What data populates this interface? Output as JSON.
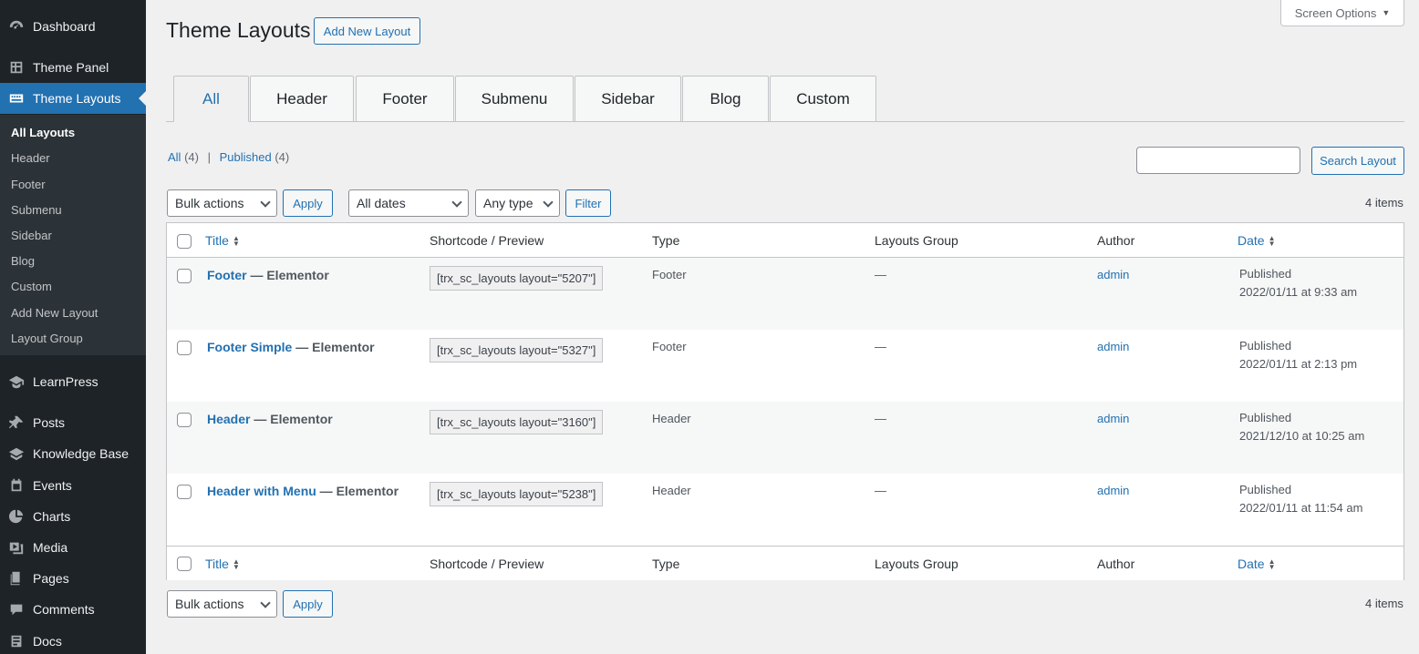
{
  "sidebar": {
    "items": [
      {
        "label": "Dashboard",
        "icon": "dashboard-icon"
      },
      {
        "label": "Theme Panel",
        "icon": "theme-panel-icon"
      },
      {
        "label": "Theme Layouts",
        "icon": "keyboard-icon"
      },
      {
        "label": "LearnPress",
        "icon": "graduation-cap-icon"
      },
      {
        "label": "Posts",
        "icon": "pushpin-icon"
      },
      {
        "label": "Knowledge Base",
        "icon": "knowledge-base-icon"
      },
      {
        "label": "Events",
        "icon": "events-icon"
      },
      {
        "label": "Charts",
        "icon": "pie-chart-icon"
      },
      {
        "label": "Media",
        "icon": "media-icon"
      },
      {
        "label": "Pages",
        "icon": "pages-icon"
      },
      {
        "label": "Comments",
        "icon": "comments-icon"
      },
      {
        "label": "Docs",
        "icon": "docs-icon"
      }
    ],
    "submenu": [
      "All Layouts",
      "Header",
      "Footer",
      "Submenu",
      "Sidebar",
      "Blog",
      "Custom",
      "Add New Layout",
      "Layout Group"
    ]
  },
  "screen_options": "Screen Options",
  "page": {
    "title": "Theme Layouts",
    "add_new": "Add New Layout"
  },
  "tabs": [
    "All",
    "Header",
    "Footer",
    "Submenu",
    "Sidebar",
    "Blog",
    "Custom"
  ],
  "filters": {
    "all_label": "All",
    "all_count": "(4)",
    "separator": "|",
    "published_label": "Published",
    "published_count": "(4)",
    "search_button": "Search Layout",
    "bulk_actions": "Bulk actions",
    "apply": "Apply",
    "dates": "All dates",
    "type": "Any type",
    "filter": "Filter",
    "items_count": "4 items"
  },
  "table": {
    "columns": {
      "title": "Title",
      "shortcode": "Shortcode / Preview",
      "type": "Type",
      "group": "Layouts Group",
      "author": "Author",
      "date": "Date"
    },
    "rows": [
      {
        "title": "Footer",
        "state": " — Elementor",
        "shortcode": "[trx_sc_layouts layout=\"5207\"]",
        "type": "Footer",
        "group": "—",
        "author": "admin",
        "status": "Published",
        "date": "2022/01/11 at 9:33 am"
      },
      {
        "title": "Footer Simple",
        "state": " — Elementor",
        "shortcode": "[trx_sc_layouts layout=\"5327\"]",
        "type": "Footer",
        "group": "—",
        "author": "admin",
        "status": "Published",
        "date": "2022/01/11 at 2:13 pm"
      },
      {
        "title": "Header",
        "state": " — Elementor",
        "shortcode": "[trx_sc_layouts layout=\"3160\"]",
        "type": "Header",
        "group": "—",
        "author": "admin",
        "status": "Published",
        "date": "2021/12/10 at 10:25 am"
      },
      {
        "title": "Header with Menu",
        "state": " — Elementor",
        "shortcode": "[trx_sc_layouts layout=\"5238\"]",
        "type": "Header",
        "group": "—",
        "author": "admin",
        "status": "Published",
        "date": "2022/01/11 at 11:54 am"
      }
    ]
  }
}
